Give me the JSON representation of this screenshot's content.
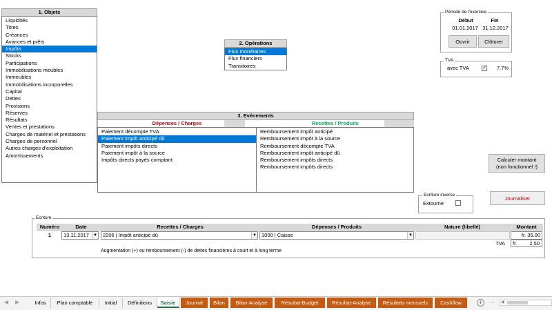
{
  "objets": {
    "title": "1. Objets",
    "items": [
      "Liquidités",
      "Titres",
      "Créances",
      "Avances et prêts",
      "Impôts",
      "Stocks",
      "Participations",
      "Immobilisations meubles",
      "Immeubles",
      "Immobilisations incorporelles",
      "Capital",
      "Dettes",
      "Provisions",
      "Réserves",
      "Résultats",
      "Ventes et prestations",
      "Charges de matériel et prestations",
      "Charges de personnel",
      "Autres charges d'exploitation",
      "Amortissements"
    ],
    "selected_index": 4
  },
  "operations": {
    "title": "2. Opérations",
    "items": [
      "Flux monétaires",
      "Flux financiers",
      "Transitoires"
    ],
    "selected_index": 0
  },
  "evenements": {
    "title": "3. Evénements",
    "depenses_header": "Dépenses / Charges",
    "recettes_header": "Recettes / Produits",
    "depenses_color": "#c00000",
    "recettes_color": "#00b050",
    "depenses": [
      "Paiement décompte TVA",
      "Paiement impôt anticipé dû",
      "Paiement impôts directs",
      "Paiement impôt à la source",
      "Impôts directs payés comptant"
    ],
    "depenses_selected_index": 1,
    "recettes": [
      "Remboursement impôt anticipé",
      "Remboursement impôt à la source",
      "Remboursement décompte TVA",
      "Remboursement impôt anticipé dû",
      "Remboursement impôts directs",
      "Remboursement impôts directs"
    ]
  },
  "periode": {
    "label": "Période de l'exercice",
    "debut_label": "Début",
    "fin_label": "Fin",
    "debut": "01.01.2017",
    "fin": "31.12.2017",
    "ouvrir": "Ouvrir",
    "cloturer": "Clôturer"
  },
  "tva": {
    "label": "TVA",
    "checkbox_label": "avec TVA",
    "checked": true,
    "rate": "7.7%"
  },
  "calculer_button": "Calculer montant (non fonctionnel !)",
  "ecriture_inverse": {
    "label": "Ecriture inverse",
    "checkbox_label": "Extourne"
  },
  "journaliser_button": "Journaliser",
  "ecriture": {
    "label": "Ecriture",
    "headers": {
      "numero": "Numéro",
      "date": "Date",
      "recettes": "Recettes / Charges",
      "depenses": "Dépenses / Produits",
      "nature": "Nature (libellé)",
      "montant": "Montant"
    },
    "numero": "1",
    "date": "13.11.2017",
    "recettes_value": "2206 | Impôt anticipé dû",
    "depenses_value": "1000 | Caisse",
    "nature": "",
    "montant": "fr. 35.00",
    "tva_label": "TVA",
    "tva_currency": "fr.",
    "tva_value": "2.50",
    "note": "Augmentation (+) ou remboursement (-) de dettes financières à court et à long terme"
  },
  "tabs": {
    "items": [
      {
        "label": "Infos",
        "style": "normal"
      },
      {
        "label": "Plan comptable",
        "style": "normal"
      },
      {
        "label": "Initial",
        "style": "normal"
      },
      {
        "label": "Définitions",
        "style": "normal"
      },
      {
        "label": "Saisie",
        "style": "active"
      },
      {
        "label": "Journal",
        "style": "orange"
      },
      {
        "label": "Bilan",
        "style": "orange"
      },
      {
        "label": "Bilan-Analyse",
        "style": "orange"
      },
      {
        "label": "Résultat-Budget",
        "style": "orange"
      },
      {
        "label": "Résultat-Analyse",
        "style": "orange"
      },
      {
        "label": "Résultats mensuels",
        "style": "orange"
      },
      {
        "label": "Cashflow",
        "style": "orange"
      }
    ],
    "add_label": "+",
    "more_label": "..."
  }
}
